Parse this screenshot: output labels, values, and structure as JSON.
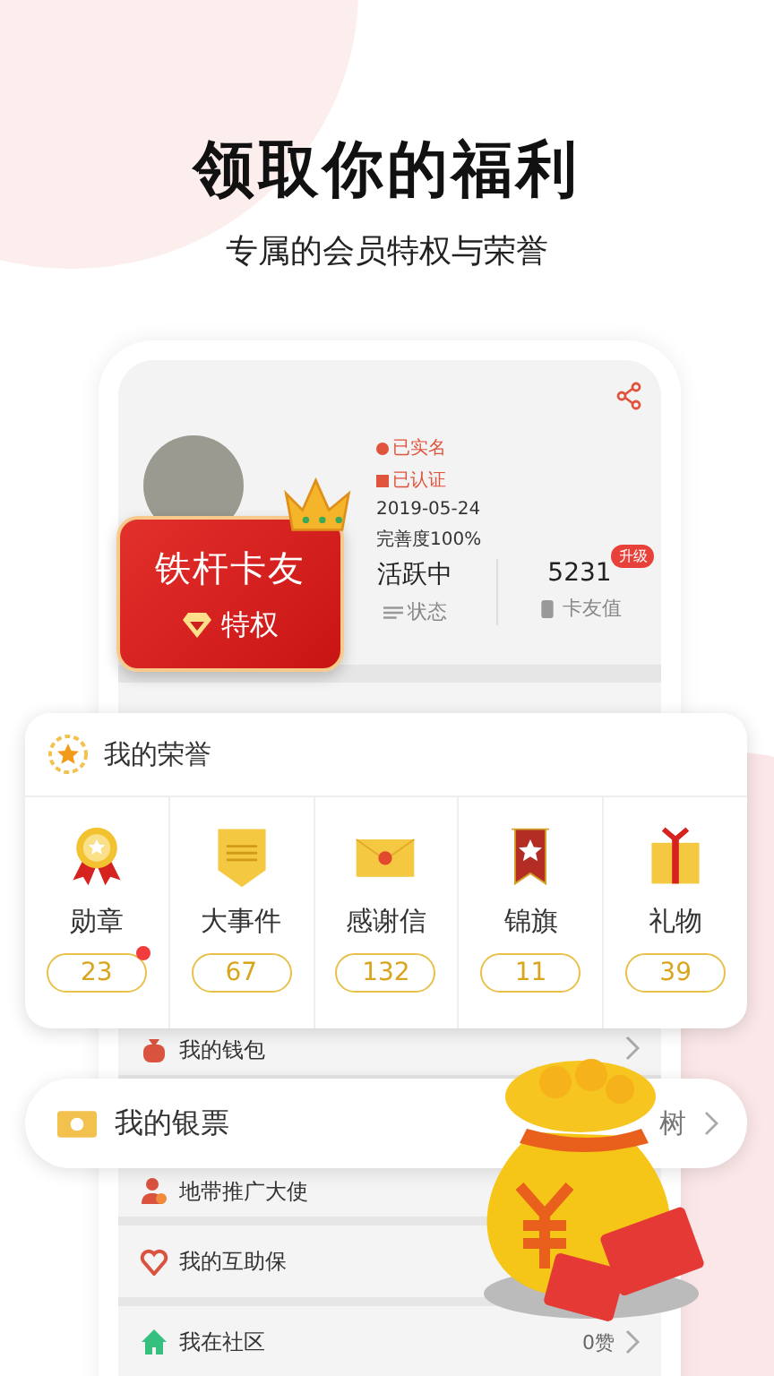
{
  "headline": {
    "title": "领取你的福利",
    "subtitle": "专属的会员特权与荣誉"
  },
  "profile": {
    "badges": [
      {
        "text": "已实名",
        "kind": "person"
      },
      {
        "text": "已认证",
        "kind": "cert"
      }
    ],
    "date": "2019-05-24",
    "completeness": "完善度100%",
    "stats": [
      {
        "value": "活跃中",
        "label": "状态",
        "kind": "status"
      },
      {
        "value": "5231",
        "label": "卡友值",
        "kind": "points",
        "tag": "升级"
      }
    ]
  },
  "member_badge": {
    "title": "铁杆卡友",
    "subtitle": "特权"
  },
  "honors": {
    "title": "我的荣誉",
    "items": [
      {
        "label": "勋章",
        "count": "23",
        "kind": "medal",
        "dot": true
      },
      {
        "label": "大事件",
        "count": "67",
        "kind": "event",
        "dot": false
      },
      {
        "label": "感谢信",
        "count": "132",
        "kind": "letter",
        "dot": false
      },
      {
        "label": "锦旗",
        "count": "11",
        "kind": "banner",
        "dot": false
      },
      {
        "label": "礼物",
        "count": "39",
        "kind": "gift",
        "dot": false
      }
    ]
  },
  "menu": [
    {
      "label": "我的钱包",
      "kind": "wallet"
    },
    {
      "label": "地带推广大使",
      "kind": "ambassador"
    },
    {
      "label": "我的互助保",
      "kind": "heart"
    },
    {
      "label": "我在社区",
      "kind": "home",
      "value": "0赞"
    }
  ],
  "ticket": {
    "label": "我的银票",
    "value": "树"
  }
}
